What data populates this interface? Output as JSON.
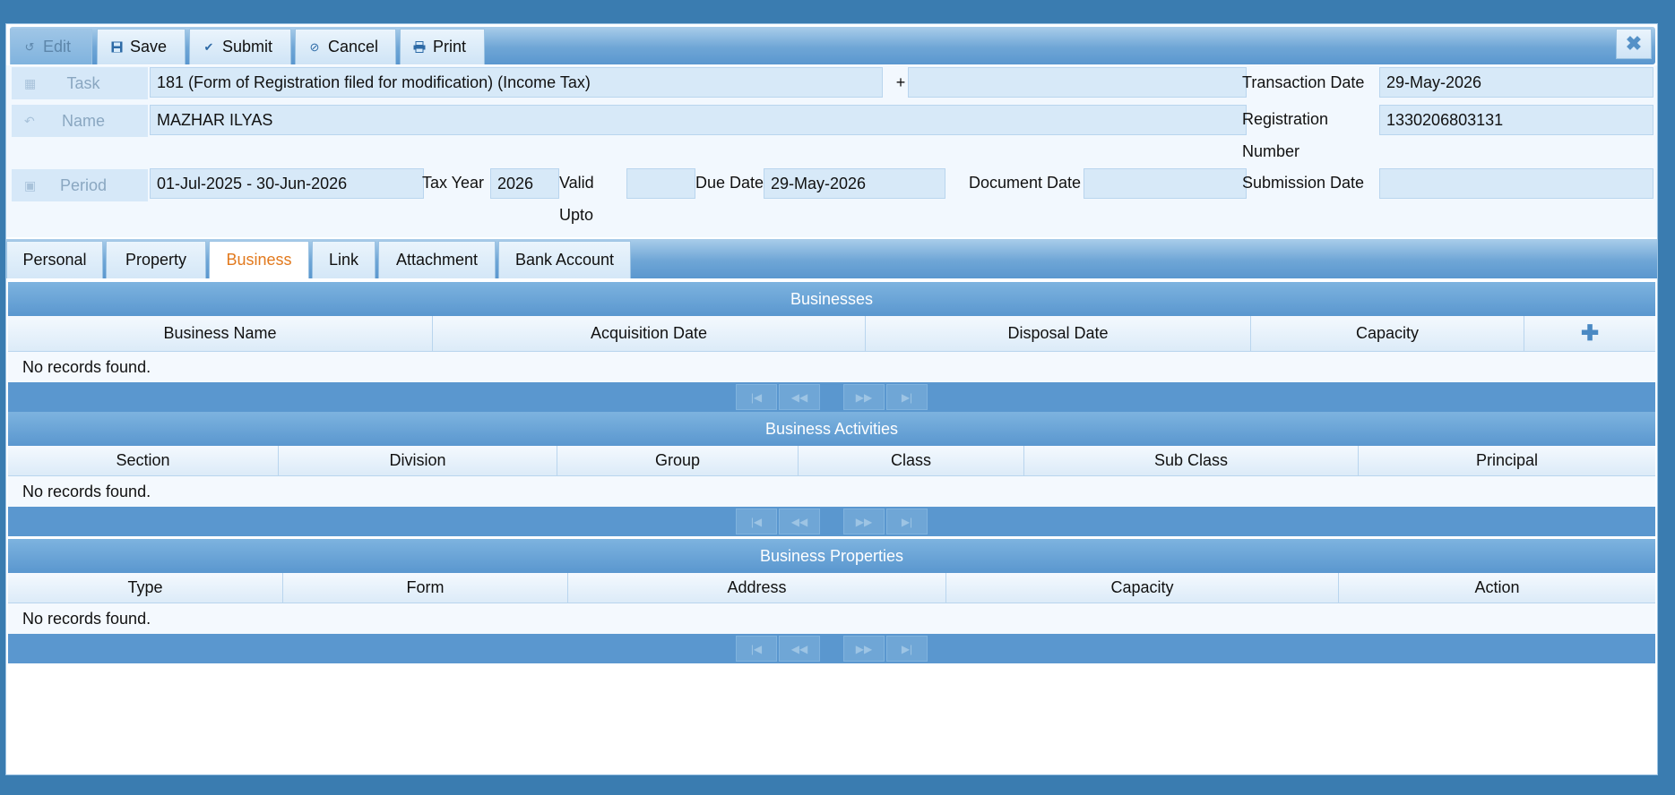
{
  "toolbar": {
    "edit_label": "Edit",
    "save_label": "Save",
    "submit_label": "Submit",
    "cancel_label": "Cancel",
    "print_label": "Print"
  },
  "form": {
    "task_label": "Task",
    "task_value": "181 (Form of Registration filed for modification) (Income Tax)",
    "task_plus": "+",
    "task_extra_value": "",
    "transaction_date_label": "Transaction Date",
    "transaction_date_value": "29-May-2026",
    "name_label": "Name",
    "name_value": "MAZHAR ILYAS",
    "registration_label_1": "Registration",
    "registration_label_2": "Number",
    "registration_value": "1330206803131",
    "period_label": "Period",
    "period_value": "01-Jul-2025 -  30-Jun-2026",
    "tax_year_label": "Tax Year",
    "tax_year_value": "2026",
    "valid_upto_label_1": "Valid",
    "valid_upto_label_2": "Upto",
    "valid_upto_value": "",
    "due_date_label": "Due Date",
    "due_date_value": "29-May-2026",
    "document_date_label": "Document Date",
    "document_date_value": "",
    "submission_date_label": "Submission Date",
    "submission_date_value": ""
  },
  "tabs": [
    {
      "label": "Personal"
    },
    {
      "label": "Property"
    },
    {
      "label": "Business"
    },
    {
      "label": "Link"
    },
    {
      "label": "Attachment"
    },
    {
      "label": "Bank Account"
    }
  ],
  "active_tab": "Business",
  "businesses": {
    "title": "Businesses",
    "columns": [
      "Business Name",
      "Acquisition Date",
      "Disposal Date",
      "Capacity"
    ],
    "empty_text": "No records found."
  },
  "activities": {
    "title": "Business Activities",
    "columns": [
      "Section",
      "Division",
      "Group",
      "Class",
      "Sub Class",
      "Principal"
    ],
    "empty_text": "No records found."
  },
  "properties": {
    "title": "Business Properties",
    "columns": [
      "Type",
      "Form",
      "Address",
      "Capacity",
      "Action"
    ],
    "empty_text": "No records found."
  },
  "pager_icons": [
    "first-page-icon",
    "prev-page-icon",
    "next-page-icon",
    "last-page-icon"
  ],
  "colors": {
    "background": "#3a7cb0",
    "header_blue": "#5a97cf",
    "field_bg": "#d7e9f8",
    "active_tab_text": "#e2791d"
  }
}
